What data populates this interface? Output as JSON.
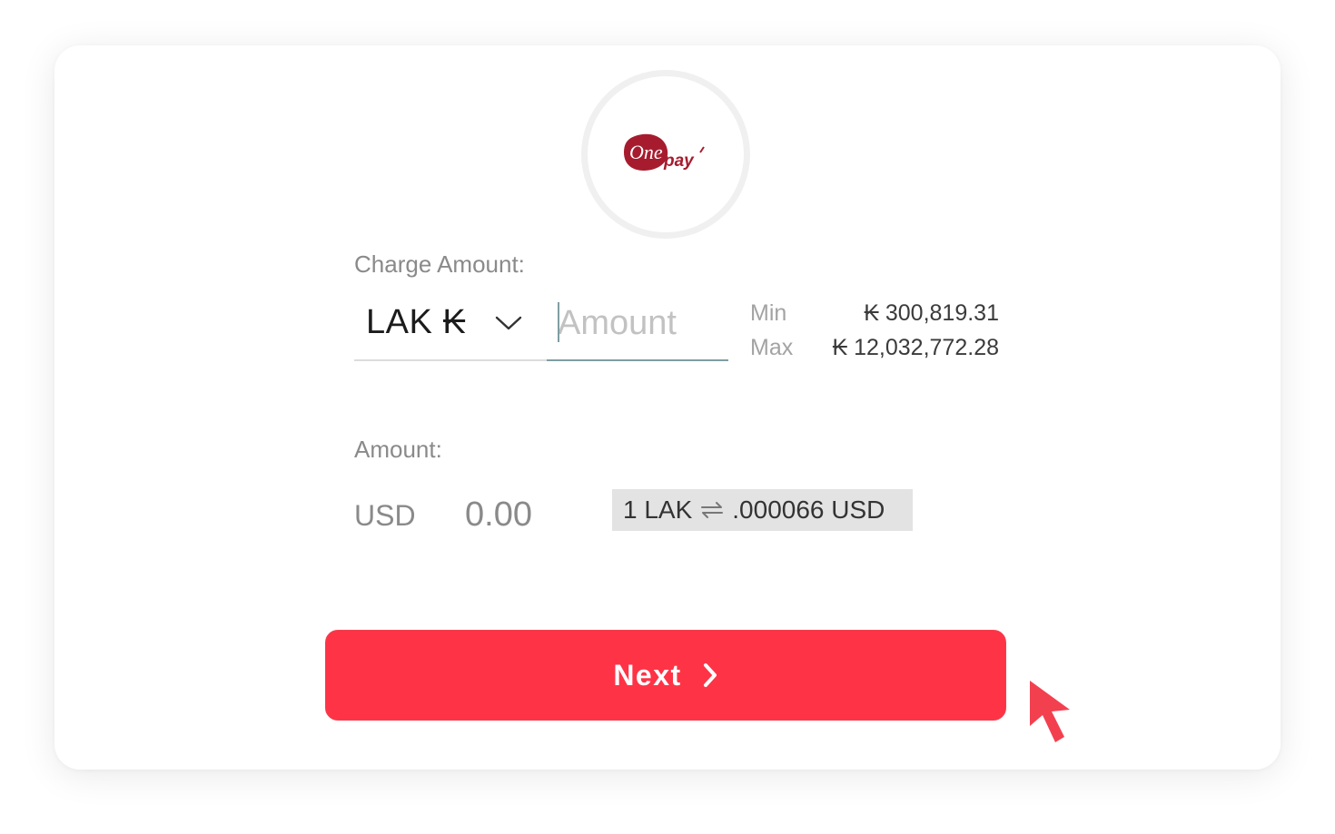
{
  "logo": {
    "brand": "One pay",
    "brand_color": "#a61c2e",
    "icon": "onepay-logo-icon"
  },
  "charge": {
    "label": "Charge Amount:",
    "currency_selected": "LAK ₭",
    "currency_dropdown_icon": "chevron-down-icon",
    "amount_placeholder": "Amount",
    "amount_value": "",
    "min_label": "Min",
    "min_value": "₭ 300,819.31",
    "max_label": "Max",
    "max_value": "₭ 12,032,772.28"
  },
  "conversion": {
    "label": "Amount:",
    "currency_code": "USD",
    "value": "0.00",
    "rate_left": "1 LAK",
    "rate_icon": "swap-arrows-icon",
    "rate_right": ".000066 USD"
  },
  "actions": {
    "next_label": "Next",
    "next_icon": "chevron-right-icon",
    "accent_color": "#ff3346"
  },
  "cursor": {
    "icon": "mouse-pointer-icon",
    "color": "#f3404f"
  }
}
